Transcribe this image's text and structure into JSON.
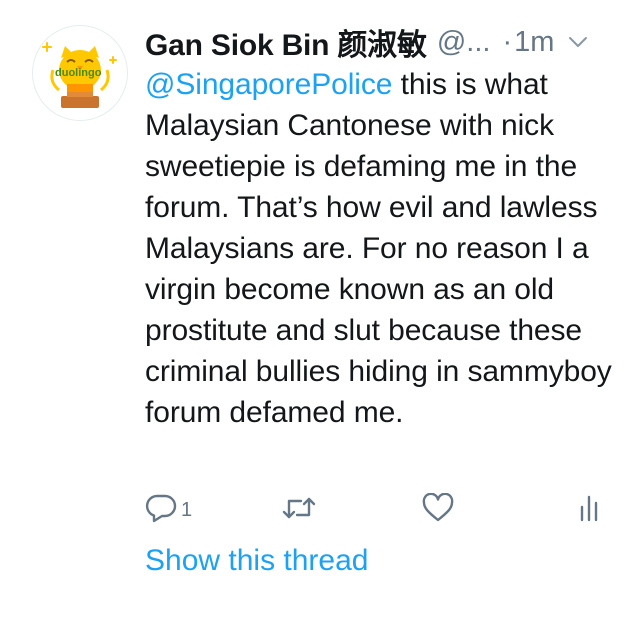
{
  "tweet": {
    "display_name": "Gan Siok Bin 颜淑敏",
    "handle": "@...",
    "separator": "·",
    "time": "1m",
    "mention": "@SingaporePolice",
    "text": " this is what Malaysian Cantonese with nick sweetiepie is defaming me in the forum. That’s how evil and lawless Malaysians are. For no reason I a virgin become known as an old prostitute and slut because these criminal bullies hiding in sammyboy forum defamed me.",
    "avatar_logo_text": "duolingo",
    "actions": {
      "reply_icon": "reply-icon",
      "reply_count": "1",
      "retweet_icon": "retweet-icon",
      "like_icon": "heart-icon",
      "analytics_icon": "analytics-icon"
    },
    "show_thread_label": "Show this thread"
  },
  "colors": {
    "link_blue": "#1da1f2",
    "muted_gray": "#657786",
    "text": "#14171a",
    "owl_yellow": "#ffc800",
    "trophy_brown": "#c9732e"
  }
}
